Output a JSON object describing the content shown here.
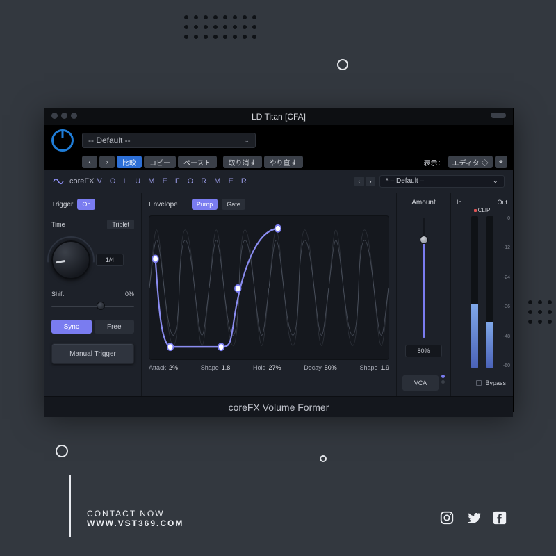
{
  "page": {
    "contact_label": "CONTACT NOW",
    "website": "WWW.VST369.COM"
  },
  "host": {
    "title": "LD Titan [CFA]",
    "preset": "-- Default --",
    "nav_prev": "‹",
    "nav_next": "›",
    "compare": "比較",
    "copy": "コピー",
    "paste": "ペースト",
    "undo": "取り消す",
    "redo": "やり直す",
    "view_label": "表示：",
    "view_mode": "エディタ ◇",
    "link": "⚭"
  },
  "plugin": {
    "brand_prefix": "coreFX",
    "brand_name": "V O L U M E   F O R M E R",
    "nav_prev": "‹",
    "nav_next": "›",
    "preset_name": "* – Default –",
    "dd_chev": "⌄",
    "footer": "coreFX Volume Former"
  },
  "trigger": {
    "label": "Trigger",
    "state": "On",
    "time_label": "Time",
    "triplet": "Triplet",
    "time_value": "1/4",
    "shift_label": "Shift",
    "shift_value": "0%",
    "shift_percent": 55,
    "sync": "Sync",
    "free": "Free",
    "manual": "Manual Trigger"
  },
  "envelope": {
    "label": "Envelope",
    "mode_pump": "Pump",
    "mode_gate": "Gate",
    "attack_label": "Attack",
    "attack_val": "2%",
    "shape1_label": "Shape",
    "shape1_val": "1.8",
    "hold_label": "Hold",
    "hold_val": "27%",
    "decay_label": "Decay",
    "decay_val": "50%",
    "shape2_label": "Shape",
    "shape2_val": "1.9"
  },
  "amount": {
    "label": "Amount",
    "value": "80%",
    "percent": 80,
    "mode": "VCA"
  },
  "io": {
    "in_label": "In",
    "out_label": "Out",
    "clip": "CLIP",
    "scale": [
      "0",
      "-12",
      "-24",
      "-36",
      "-48",
      "-60"
    ],
    "in_level": 42,
    "out_level": 30,
    "bypass": "Bypass"
  }
}
